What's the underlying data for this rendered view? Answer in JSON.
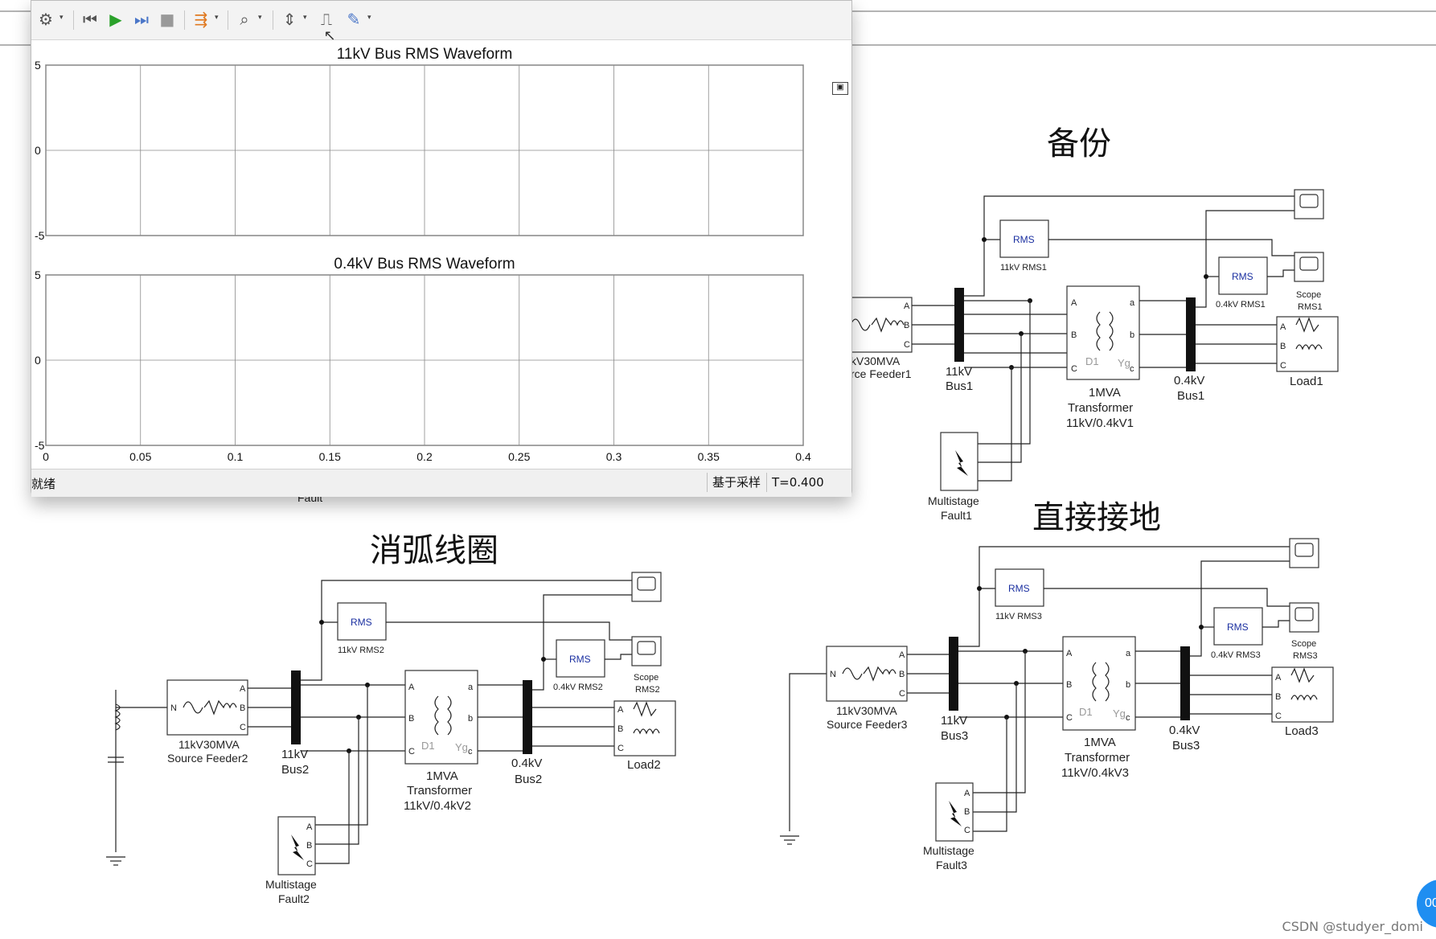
{
  "diagram": {
    "sections": {
      "backup": "备份",
      "arc_suppression": "消弧线圈",
      "direct_ground": "直接接地"
    },
    "blocks": {
      "src1": [
        "kV30MVA",
        "rce Feeder1"
      ],
      "src2": [
        "11kV30MVA",
        "Source Feeder2"
      ],
      "src3": [
        "11kV30MVA",
        "Source Feeder3"
      ],
      "bus11_1": [
        "11kV",
        "Bus1"
      ],
      "bus11_2": [
        "11kV",
        "Bus2"
      ],
      "bus11_3": [
        "11kV",
        "Bus3"
      ],
      "bus04_1": [
        "0.4kV",
        "Bus1"
      ],
      "bus04_2": [
        "0.4kV",
        "Bus2"
      ],
      "bus04_3": [
        "0.4kV",
        "Bus3"
      ],
      "tr1": [
        "1MVA",
        "Transformer",
        "11kV/0.4kV1"
      ],
      "tr2": [
        "1MVA",
        "Transformer",
        "11kV/0.4kV2"
      ],
      "tr3": [
        "1MVA",
        "Transformer",
        "11kV/0.4kV3"
      ],
      "fault1": [
        "Multistage",
        "Fault1"
      ],
      "fault2": [
        "Multistage",
        "Fault2"
      ],
      "fault3": [
        "Multistage",
        "Fault3"
      ],
      "load1": "Load1",
      "load2": "Load2",
      "load3": "Load3",
      "rms_text": "RMS",
      "rms11_1": "11kV RMS1",
      "rms11_2": "11kV RMS2",
      "rms11_3": "11kV RMS3",
      "rms04_1": "0.4kV RMS1",
      "rms04_2": "0.4kV RMS2",
      "rms04_3": "0.4kV RMS3",
      "scope1": [
        "Scope",
        "RMS1"
      ],
      "scope2": [
        "Scope",
        "RMS2"
      ],
      "scope3": [
        "Scope",
        "RMS3"
      ],
      "fault_partial": "Fault",
      "port_a": "A",
      "port_b": "B",
      "port_c": "C",
      "port_la": "a",
      "port_lb": "b",
      "port_lc": "c",
      "port_n": "N",
      "winding_d1": "D1",
      "winding_yg": "Yg"
    }
  },
  "scope_window": {
    "plots": [
      {
        "title": "11kV Bus RMS Waveform",
        "yticks": [
          "5",
          "0",
          "-5"
        ]
      },
      {
        "title": "0.4kV Bus RMS Waveform",
        "yticks": [
          "5",
          "0",
          "-5"
        ]
      }
    ],
    "xticks": [
      "0",
      "0.05",
      "0.1",
      "0.15",
      "0.2",
      "0.25",
      "0.3",
      "0.35",
      "0.4"
    ],
    "status": {
      "left": "就绪",
      "mode": "基于采样",
      "time": "T=0.400"
    },
    "toolbar_icons": [
      "gear-icon",
      "step-back-icon",
      "run-icon",
      "step-forward-icon",
      "stop-icon",
      "highlight-icon",
      "zoom-icon",
      "autoscale-icon",
      "trigger-icon",
      "style-icon"
    ],
    "undock": "▣"
  },
  "chart_data": [
    {
      "type": "line",
      "title": "11kV Bus RMS Waveform",
      "series": [],
      "ylim": [
        -5,
        5
      ],
      "xlim": [
        0,
        0.4
      ],
      "grid": true
    },
    {
      "type": "line",
      "title": "0.4kV Bus RMS Waveform",
      "series": [],
      "ylim": [
        -5,
        5
      ],
      "xlim": [
        0,
        0.4
      ],
      "grid": true
    }
  ],
  "watermark": "CSDN @studyer_domi",
  "bubble": "00"
}
